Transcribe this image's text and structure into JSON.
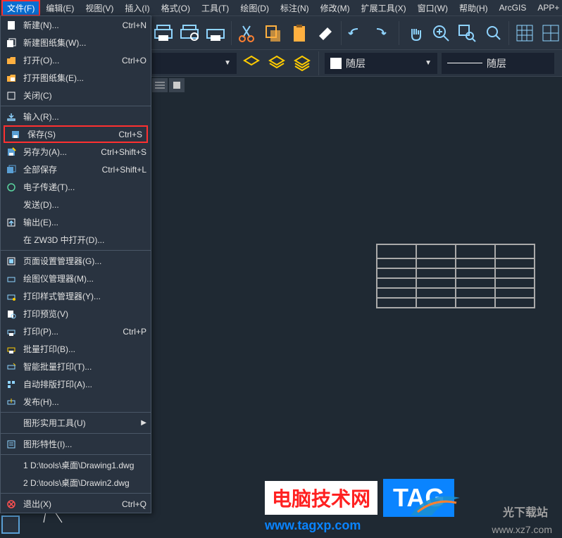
{
  "menubar": {
    "items": [
      {
        "label": "文件(F)",
        "active": true
      },
      {
        "label": "编辑(E)"
      },
      {
        "label": "视图(V)"
      },
      {
        "label": "插入(I)"
      },
      {
        "label": "格式(O)"
      },
      {
        "label": "工具(T)"
      },
      {
        "label": "绘图(D)"
      },
      {
        "label": "标注(N)"
      },
      {
        "label": "修改(M)"
      },
      {
        "label": "扩展工具(X)"
      },
      {
        "label": "窗口(W)"
      },
      {
        "label": "帮助(H)"
      },
      {
        "label": "ArcGIS"
      },
      {
        "label": "APP+"
      }
    ]
  },
  "file_menu": {
    "groups": [
      [
        {
          "icon": "new-icon",
          "label": "新建(N)...",
          "shortcut": "Ctrl+N"
        },
        {
          "icon": "new-sheet-icon",
          "label": "新建图纸集(W)..."
        },
        {
          "icon": "open-icon",
          "label": "打开(O)...",
          "shortcut": "Ctrl+O"
        },
        {
          "icon": "open-sheet-icon",
          "label": "打开图纸集(E)..."
        },
        {
          "icon": "close-icon",
          "label": "关闭(C)"
        }
      ],
      [
        {
          "icon": "import-icon",
          "label": "输入(R)..."
        },
        {
          "icon": "save-icon",
          "label": "保存(S)",
          "shortcut": "Ctrl+S",
          "highlighted": true
        },
        {
          "icon": "saveas-icon",
          "label": "另存为(A)...",
          "shortcut": "Ctrl+Shift+S"
        },
        {
          "icon": "saveall-icon",
          "label": "全部保存",
          "shortcut": "Ctrl+Shift+L"
        },
        {
          "icon": "etransmit-icon",
          "label": "电子传递(T)..."
        },
        {
          "icon": "",
          "label": "发送(D)..."
        },
        {
          "icon": "export-icon",
          "label": "输出(E)..."
        },
        {
          "icon": "",
          "label": "在 ZW3D 中打开(D)..."
        }
      ],
      [
        {
          "icon": "pagesetup-icon",
          "label": "页面设置管理器(G)..."
        },
        {
          "icon": "plotter-icon",
          "label": "绘图仪管理器(M)..."
        },
        {
          "icon": "plotstyle-icon",
          "label": "打印样式管理器(Y)..."
        },
        {
          "icon": "preview-icon",
          "label": "打印预览(V)"
        },
        {
          "icon": "print-icon",
          "label": "打印(P)...",
          "shortcut": "Ctrl+P"
        },
        {
          "icon": "batchprint-icon",
          "label": "批量打印(B)..."
        },
        {
          "icon": "smartprint-icon",
          "label": "智能批量打印(T)..."
        },
        {
          "icon": "autolayout-icon",
          "label": "自动排版打印(A)..."
        },
        {
          "icon": "publish-icon",
          "label": "发布(H)..."
        }
      ],
      [
        {
          "icon": "",
          "label": "图形实用工具(U)",
          "submenu": true
        }
      ],
      [
        {
          "icon": "properties-icon",
          "label": "图形特性(I)..."
        }
      ],
      [
        {
          "icon": "",
          "label": "1 D:\\tools\\桌面\\Drawing1.dwg"
        },
        {
          "icon": "",
          "label": "2 D:\\tools\\桌面\\Drawin2.dwg"
        }
      ],
      [
        {
          "icon": "exit-icon",
          "label": "退出(X)",
          "shortcut": "Ctrl+Q"
        }
      ]
    ]
  },
  "layer_bar": {
    "bylayer1": "随层",
    "bylayer2": "随层"
  },
  "watermark": {
    "title": "电脑技术网",
    "url": "www.tagxp.com",
    "tag": "TAG",
    "extra_text": "光下载站",
    "extra_url": "www.xz7.com"
  }
}
